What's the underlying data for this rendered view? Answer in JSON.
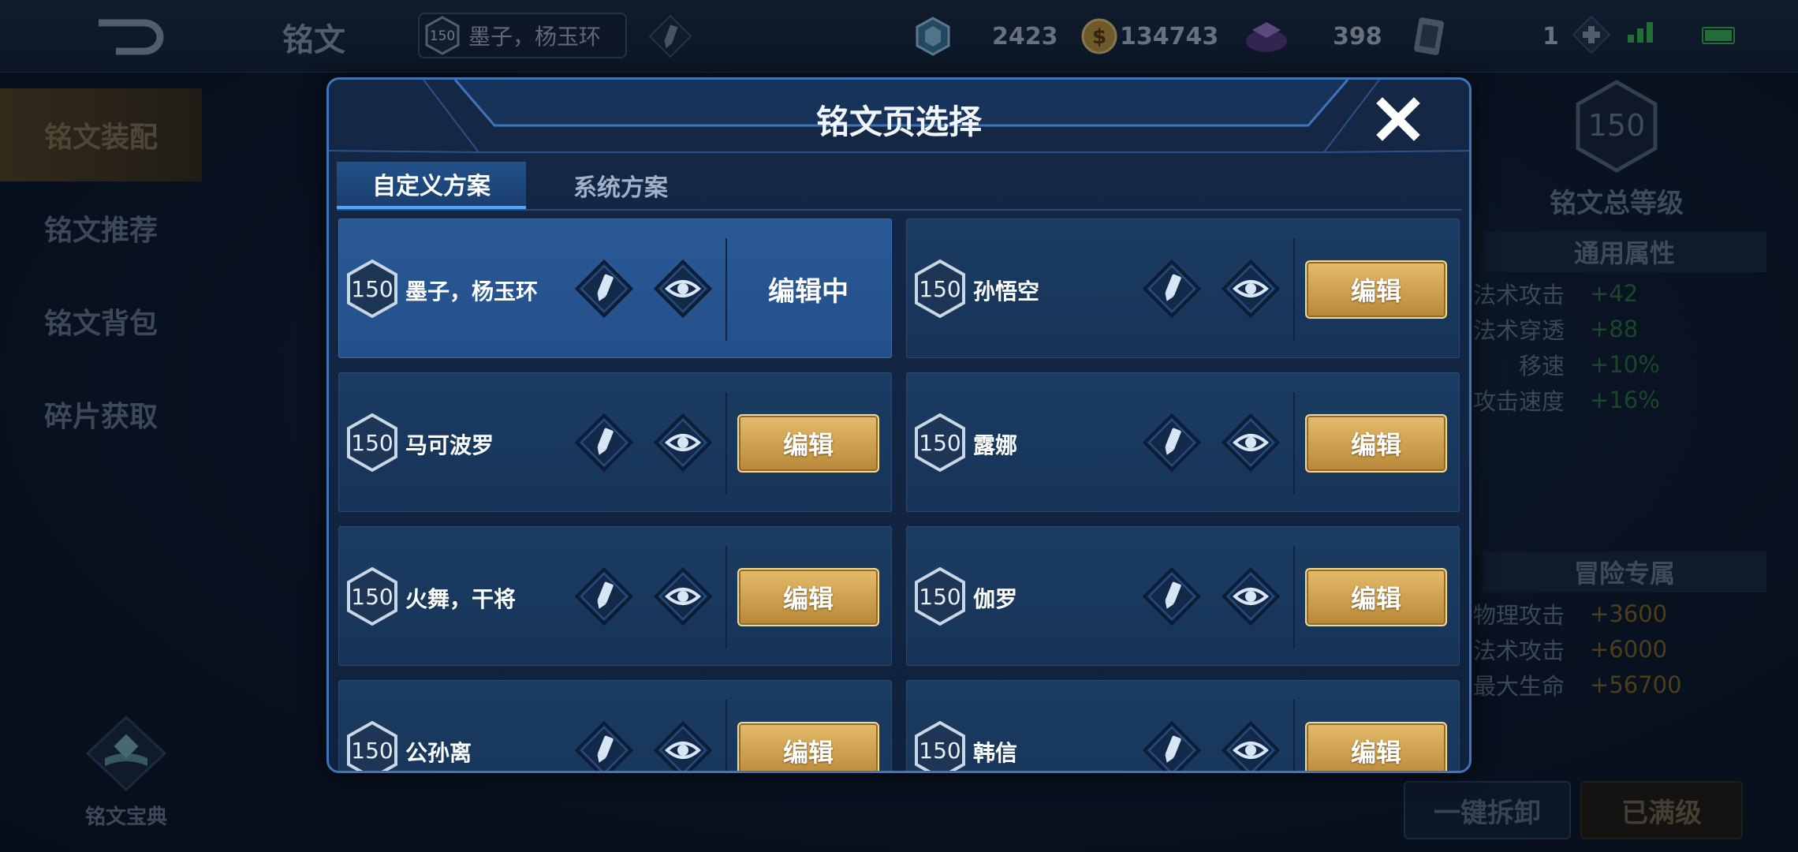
{
  "topbar": {
    "title": "铭文",
    "active_page": {
      "level": "150",
      "name": "墨子，杨玉环"
    },
    "resources": [
      {
        "icon": "crystal-icon",
        "value": "2423"
      },
      {
        "icon": "gold-coin-icon",
        "value": "134743"
      },
      {
        "icon": "diamond-icon",
        "value": "398"
      },
      {
        "icon": "ticket-icon",
        "value": "1"
      }
    ]
  },
  "leftnav": {
    "items": [
      "铭文装配",
      "铭文推荐",
      "铭文背包",
      "碎片获取"
    ],
    "codex_label": "铭文宝典"
  },
  "right_panel": {
    "total_level": "150",
    "total_level_label": "铭文总等级",
    "general_title": "通用属性",
    "general_attrs": [
      {
        "name": "法术攻击",
        "value": "+42"
      },
      {
        "name": "法术穿透",
        "value": "+88"
      },
      {
        "name": "移速",
        "value": "+10%"
      },
      {
        "name": "攻击速度",
        "value": "+16%"
      }
    ],
    "adventure_title": "冒险专属",
    "adventure_attrs": [
      {
        "name": "物理攻击",
        "value": "+3600"
      },
      {
        "name": "法术攻击",
        "value": "+6000"
      },
      {
        "name": "最大生命",
        "value": "+56700"
      }
    ],
    "disassemble_label": "一键拆卸",
    "maxed_label": "已满级"
  },
  "modal": {
    "title": "铭文页选择",
    "tabs": [
      "自定义方案",
      "系统方案"
    ],
    "pages": [
      {
        "level": "150",
        "name": "墨子，杨玉环",
        "status": "编辑中"
      },
      {
        "level": "150",
        "name": "孙悟空",
        "status": "编辑"
      },
      {
        "level": "150",
        "name": "马可波罗",
        "status": "编辑"
      },
      {
        "level": "150",
        "name": "露娜",
        "status": "编辑"
      },
      {
        "level": "150",
        "name": "火舞，干将",
        "status": "编辑"
      },
      {
        "level": "150",
        "name": "伽罗",
        "status": "编辑"
      },
      {
        "level": "150",
        "name": "公孙离",
        "status": "编辑"
      },
      {
        "level": "150",
        "name": "韩信",
        "status": "编辑"
      }
    ]
  },
  "colors": {
    "gold_button": "#d9ab58",
    "selected_card": "#2a5996",
    "card": "#1b3c63",
    "tab_accent": "#49a8ff",
    "positive_attr": "#3fa552",
    "adventure_attr": "#d19a34"
  }
}
